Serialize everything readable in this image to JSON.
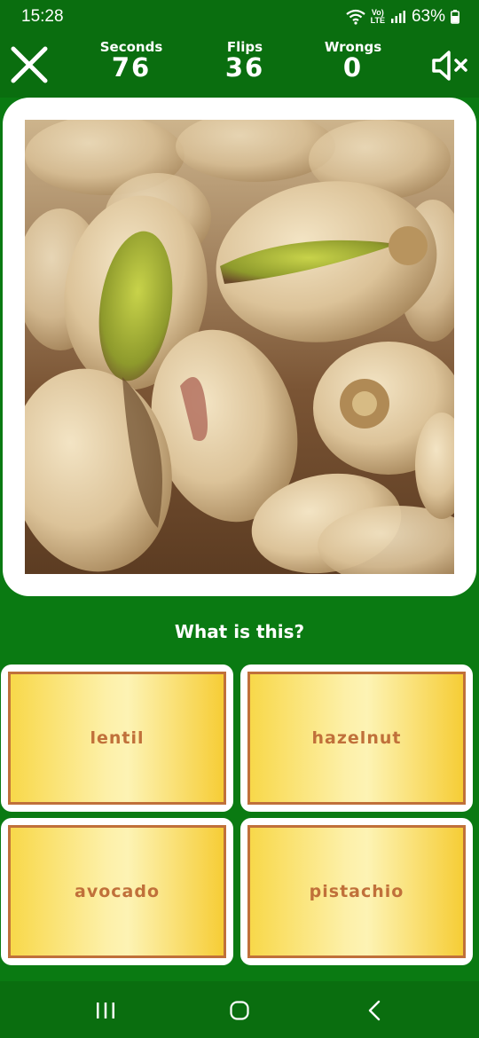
{
  "status_bar": {
    "time": "15:28",
    "network": "LTE",
    "battery": "63%"
  },
  "stats": [
    {
      "label": "Seconds",
      "value": "76"
    },
    {
      "label": "Flips",
      "value": "36"
    },
    {
      "label": "Wrongs",
      "value": "0"
    }
  ],
  "question": "What is this?",
  "answers": [
    "lentil",
    "hazelnut",
    "avocado",
    "pistachio"
  ],
  "icons": [
    "close-icon",
    "mute-icon",
    "wifi-icon",
    "signal-icon",
    "battery-icon",
    "recents-icon",
    "home-icon",
    "back-icon"
  ],
  "colors": {
    "background": "#0a7a12",
    "answer_border": "#c0703a",
    "answer_fill": "#f8d84a"
  }
}
